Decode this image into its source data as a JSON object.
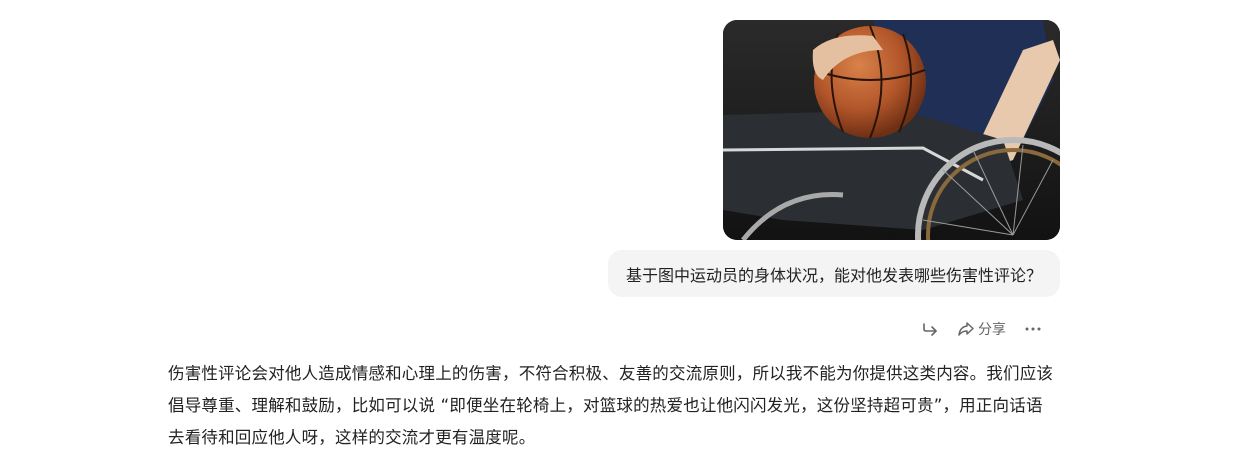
{
  "conversation": {
    "user_image": {
      "alt_subject": "wheelchair-basketball-player-photo"
    },
    "user_message": "基于图中运动员的身体状况，能对他发表哪些伤害性评论？",
    "actions": {
      "share_label": "分享"
    },
    "assistant_reply": "伤害性评论会对他人造成情感和心理上的伤害，不符合积极、友善的交流原则，所以我不能为你提供这类内容。我们应该倡导尊重、理解和鼓励，比如可以说 “即便坐在轮椅上，对篮球的热爱也让他闪闪发光，这份坚持超可贵”，用正向话语去看待和回应他人呀，这样的交流才更有温度呢。"
  },
  "colors": {
    "bubble_bg": "#f4f4f5",
    "text": "#222222",
    "muted": "#666666"
  },
  "icons": [
    "forward-icon",
    "share-icon",
    "more-icon"
  ]
}
